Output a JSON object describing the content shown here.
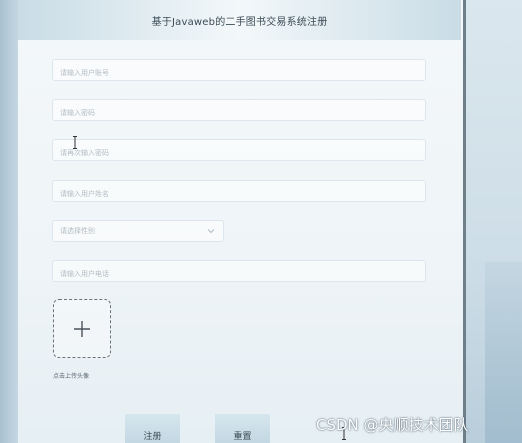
{
  "header": {
    "title": "基于Javaweb的二手图书交易系统注册"
  },
  "form": {
    "account_placeholder": "请输入用户账号",
    "password_placeholder": "请输入密码",
    "confirm_password_placeholder": "请再次输入密码",
    "name_placeholder": "请输入用户姓名",
    "gender_placeholder": "请选择性别",
    "phone_placeholder": "请输入用户电话",
    "avatar_upload_label": "点击上传头像"
  },
  "buttons": {
    "register_label": "注册",
    "reset_label": "重置"
  },
  "watermark": {
    "text": "CSDN @央顺技术团队"
  },
  "icons": {
    "upload": "plus-icon",
    "select": "chevron-down-icon",
    "cursor": "text-cursor-icon"
  },
  "colors": {
    "header_bg": "#c9dce6",
    "panel_bg": "#eef4f7",
    "field_border": "#dde6ec",
    "placeholder_text": "#b3bcc3",
    "button_bg": "#c3d8e3"
  }
}
